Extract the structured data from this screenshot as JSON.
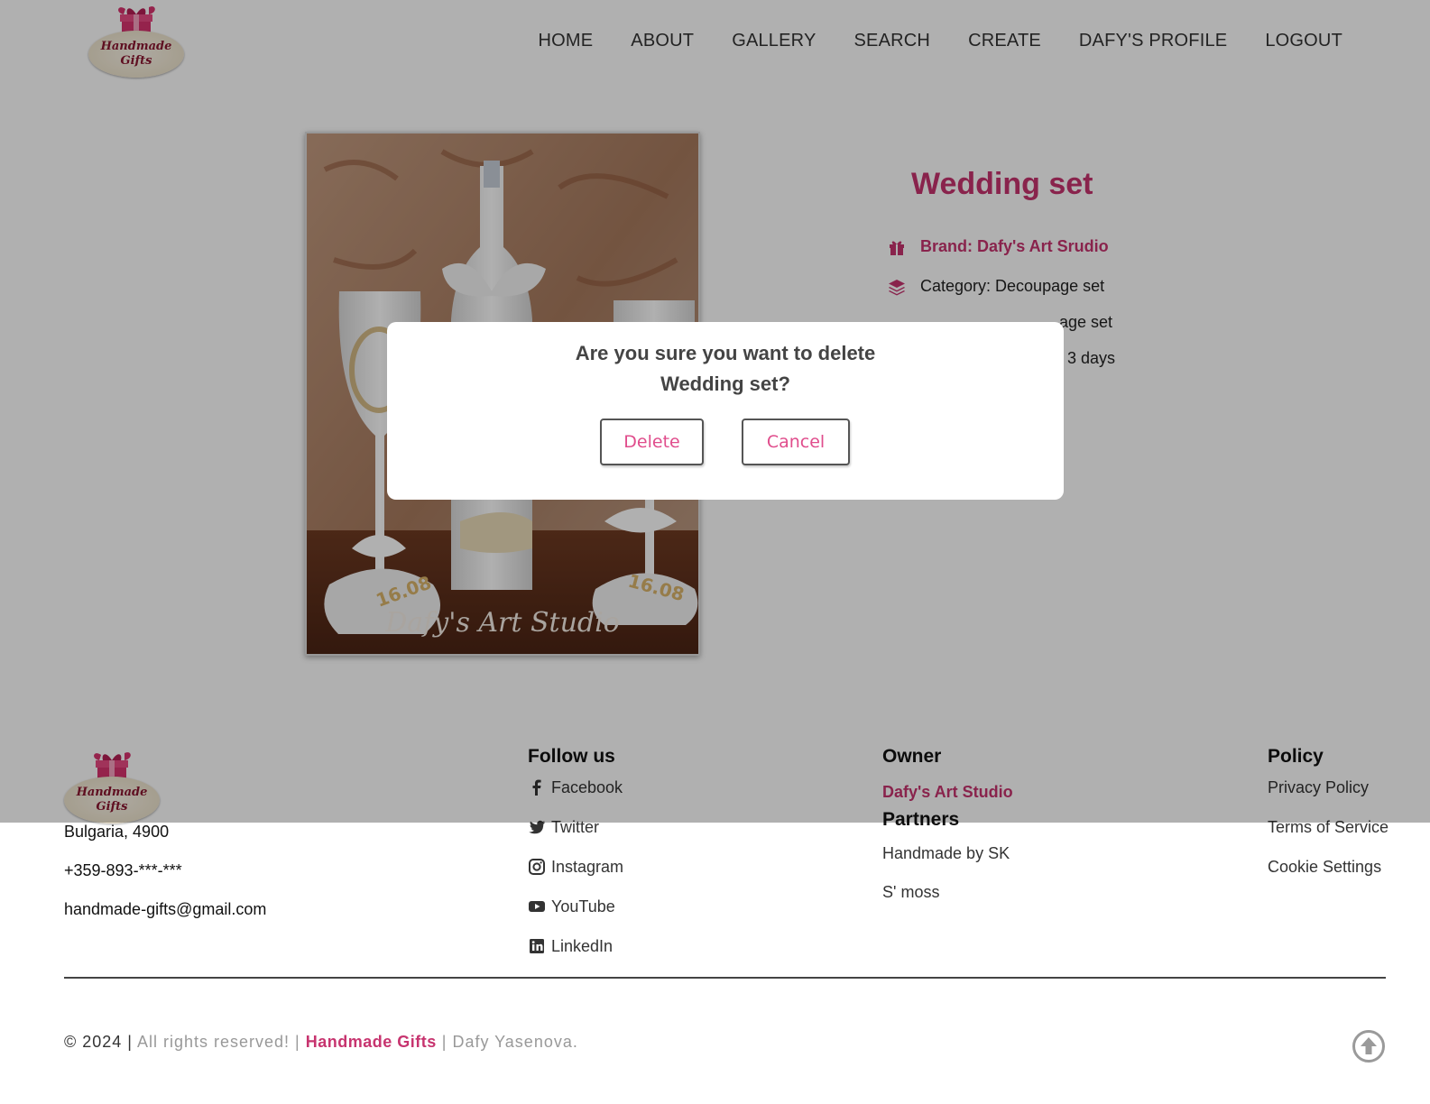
{
  "header": {
    "logo": {
      "line1": "Handmade",
      "line2": "Gifts"
    },
    "nav": [
      "HOME",
      "ABOUT",
      "GALLERY",
      "SEARCH",
      "CREATE",
      "DAFY'S PROFILE",
      "LOGOUT"
    ]
  },
  "product": {
    "title": "Wedding set",
    "photo_watermark": "Dafy's Art Studio",
    "photo_date": "16.08",
    "brand": "Brand: Dafy's Art Srudio",
    "category": "Category: Decoupage set",
    "row3_partial": "age set",
    "row4_partial": "3 days"
  },
  "modal": {
    "question_line1": "Are you sure you want to delete",
    "question_line2": "Wedding set?",
    "delete_label": "Delete",
    "cancel_label": "Cancel"
  },
  "footer": {
    "logo": {
      "line1": "Handmade",
      "line2": "Gifts"
    },
    "address": "Bulgaria, 4900",
    "phone": "+359-893-***-***",
    "email": "handmade-gifts@gmail.com",
    "follow_title": "Follow us",
    "social": [
      {
        "icon": "facebook-icon",
        "label": "Facebook"
      },
      {
        "icon": "twitter-icon",
        "label": "Twitter"
      },
      {
        "icon": "instagram-icon",
        "label": "Instagram"
      },
      {
        "icon": "youtube-icon",
        "label": "YouTube"
      },
      {
        "icon": "linkedin-icon",
        "label": "LinkedIn"
      }
    ],
    "owner_title": "Owner",
    "owner_name": "Dafy's Art Studio",
    "partners_title": "Partners",
    "partners": [
      "Handmade by SK",
      "S' moss"
    ],
    "policy_title": "Policy",
    "policy_links": [
      "Privacy Policy",
      "Terms of Service",
      "Cookie Settings"
    ],
    "copyright_prefix": "© 2024 |",
    "copyright_middle": " All rights reserved! | ",
    "copyright_brand": "Handmade Gifts",
    "copyright_suffix": " | Dafy Yasenova."
  },
  "colors": {
    "accent": "#c7346f",
    "button_text": "#e04d8c",
    "overlay": "rgba(0,0,0,0.31)"
  }
}
